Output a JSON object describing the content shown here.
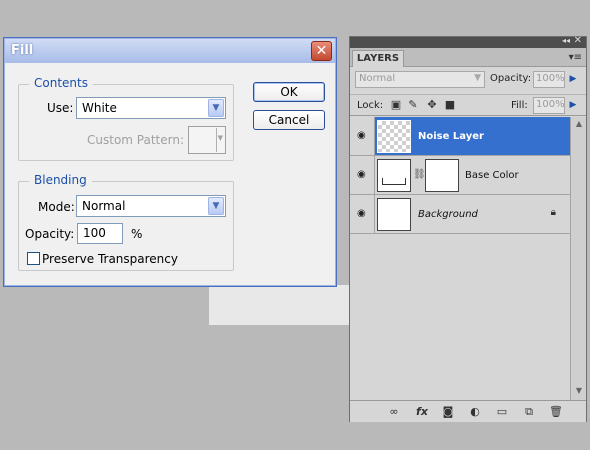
{
  "fill_dialog": {
    "title": "Fill",
    "close_glyph": "✕",
    "contents": {
      "group_title": "Contents",
      "use_label": "Use:",
      "use_value": "White",
      "custom_pattern_label": "Custom Pattern:"
    },
    "blending": {
      "group_title": "Blending",
      "mode_label": "Mode:",
      "mode_value": "Normal",
      "opacity_label": "Opacity:",
      "opacity_value": "100",
      "opacity_unit": "%",
      "preserve_label": "Preserve Transparency",
      "preserve_checked": false
    },
    "ok_label": "OK",
    "cancel_label": "Cancel"
  },
  "layers_panel": {
    "tab_label": "LAYERS",
    "collapse_glyph": "◂◂",
    "close_glyph": "✕",
    "menu_glyph": "▾≡",
    "blend_mode": "Normal",
    "opacity_label": "Opacity:",
    "opacity_value": "100%",
    "lock_label": "Lock:",
    "fill_label": "Fill:",
    "fill_value": "100%",
    "layers": [
      {
        "name": "Noise Layer",
        "selected": true,
        "thumb": "transparent",
        "visible": true
      },
      {
        "name": "Base Color",
        "selected": false,
        "thumb": "fill-with-mask",
        "visible": true
      },
      {
        "name": "Background",
        "selected": false,
        "thumb": "white",
        "visible": true,
        "locked": true
      }
    ],
    "icons": [
      "link-icon",
      "fx-icon",
      "mask-icon",
      "adjustment-icon",
      "group-icon",
      "new-layer-icon",
      "trash-icon"
    ],
    "accent_color": "#3670ce"
  }
}
